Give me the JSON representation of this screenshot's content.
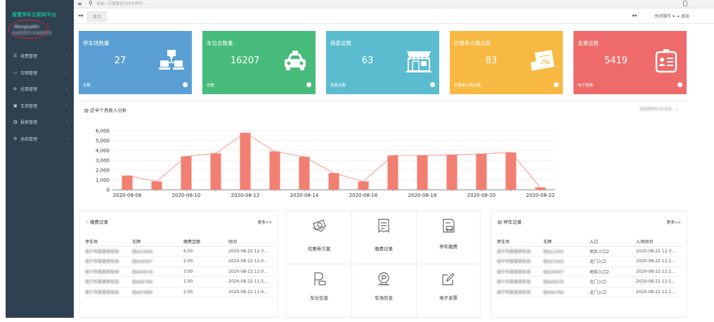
{
  "app": {
    "brand": "智慧停车互联网平台",
    "user_name": "Mangoadm",
    "user_role": "系统管理员/系统管理员"
  },
  "colors": {
    "sidebar_bg": "#2f4050",
    "brand_green": "#1ab394",
    "card_blue": "#5a9fd4",
    "card_green": "#47bb7a",
    "card_teal": "#5bbccf",
    "card_yellow": "#f7b941",
    "card_red": "#ef6b6b",
    "bar_color": "#f28072"
  },
  "sidebar": {
    "items": [
      {
        "icon": "list-icon",
        "label": "收费管理"
      },
      {
        "icon": "car-icon",
        "label": "车辆管理"
      },
      {
        "icon": "gift-icon",
        "label": "优惠管理"
      },
      {
        "icon": "parking-icon",
        "label": "车场管理"
      },
      {
        "icon": "chart-icon",
        "label": "报表管理"
      },
      {
        "icon": "gears-icon",
        "label": "系统管理"
      }
    ]
  },
  "topbar": {
    "search_placeholder": "请输入您需要查找的车牌号 ..."
  },
  "tabs": {
    "home": "首页",
    "close_ops": "关闭操作",
    "logout": "退出"
  },
  "stats": [
    {
      "title": "停车场数量",
      "value": "27",
      "foot": "总数",
      "icon": "network-icon"
    },
    {
      "title": "车位总数量",
      "value": "16207",
      "foot": "总数",
      "icon": "taxi-icon"
    },
    {
      "title": "商家总数",
      "value": "63",
      "foot": "商家总数",
      "icon": "store-icon"
    },
    {
      "title": "优惠券方案总数",
      "value": "83",
      "foot": "优惠券方案总数",
      "icon": "coupon-icon"
    },
    {
      "title": "发票总数",
      "value": "5419",
      "foot": "电子发票",
      "icon": "invoice-icon"
    }
  ],
  "chart_section": {
    "title": "近半个月收入分析",
    "selector": "请选择停车场/全部"
  },
  "chart_data": {
    "type": "bar",
    "title": "",
    "categories": [
      "2020-08-08",
      "2020-08-09",
      "2020-08-10",
      "2020-08-11",
      "2020-08-12",
      "2020-08-13",
      "2020-08-14",
      "2020-08-15",
      "2020-08-16",
      "2020-08-17",
      "2020-08-18",
      "2020-08-19",
      "2020-08-20",
      "2020-08-21",
      "2020-08-22"
    ],
    "tick_labels": [
      "2020-08-08",
      "2020-08-10",
      "2020-08-12",
      "2020-08-14",
      "2020-08-16",
      "2020-08-18",
      "2020-08-20",
      "2020-08-22"
    ],
    "values": [
      1450,
      850,
      3400,
      3700,
      5800,
      3900,
      3350,
      1700,
      850,
      3500,
      3500,
      3550,
      3650,
      3800,
      250
    ],
    "yticks": [
      "0",
      "1,000",
      "2,000",
      "3,000",
      "4,000",
      "5,000",
      "6,000"
    ],
    "ylim": [
      0,
      6000
    ],
    "overlay_line": true,
    "grid": true
  },
  "payment_records": {
    "title": "缴费记录",
    "more": "更多>>",
    "headers": [
      "停车场",
      "车牌",
      "缴费金额",
      "时间"
    ],
    "rows": [
      [
        "南宁市某某停车场",
        "桂A23456",
        "6.00",
        "2020-08-22 12:3..."
      ],
      [
        "南宁市某某停车场",
        "桂A34567",
        "2.00",
        "2020-08-22 12:0..."
      ],
      [
        "南宁市某某停车场",
        "桂A45678",
        "3.00",
        "2020-08-22 12:0..."
      ],
      [
        "南宁市某某停车场",
        "桂A56789",
        "1.00",
        "2020-08-22 11:5..."
      ],
      [
        "南宁市某某停车场",
        "桂A67890",
        "2.00",
        "2020-08-22 11:4..."
      ]
    ]
  },
  "quick_links": [
    {
      "label": "优惠券方案",
      "icon": "coupon-scheme-icon"
    },
    {
      "label": "缴费记录",
      "icon": "receipt-icon"
    },
    {
      "label": "停车缴费",
      "icon": "parking-payment-icon"
    },
    {
      "label": "车位信息",
      "icon": "parking-space-icon"
    },
    {
      "label": "车场信息",
      "icon": "location-icon"
    },
    {
      "label": "电子发票",
      "icon": "edit-invoice-icon"
    }
  ],
  "parking_records": {
    "title": "停车记录",
    "more": "更多>>",
    "headers": [
      "停车场",
      "车牌",
      "入口",
      "入场时间"
    ],
    "rows": [
      [
        "南宁市某某停车场",
        "桂A12345",
        "地库入口2",
        "2020-08-22 12:3..."
      ],
      [
        "南宁市某某停车场",
        "桂A23456",
        "北门入口",
        "2020-08-22 12:2..."
      ],
      [
        "南宁市某某停车场",
        "桂A34567",
        "地库入口2",
        "2020-08-22 12:2..."
      ],
      [
        "南宁市某某停车场",
        "桂A45678",
        "北门入口",
        "2020-08-22 12:1..."
      ],
      [
        "南宁市某某停车场",
        "桂A56789",
        "北门入口",
        "2020-08-22 12:1..."
      ]
    ]
  }
}
